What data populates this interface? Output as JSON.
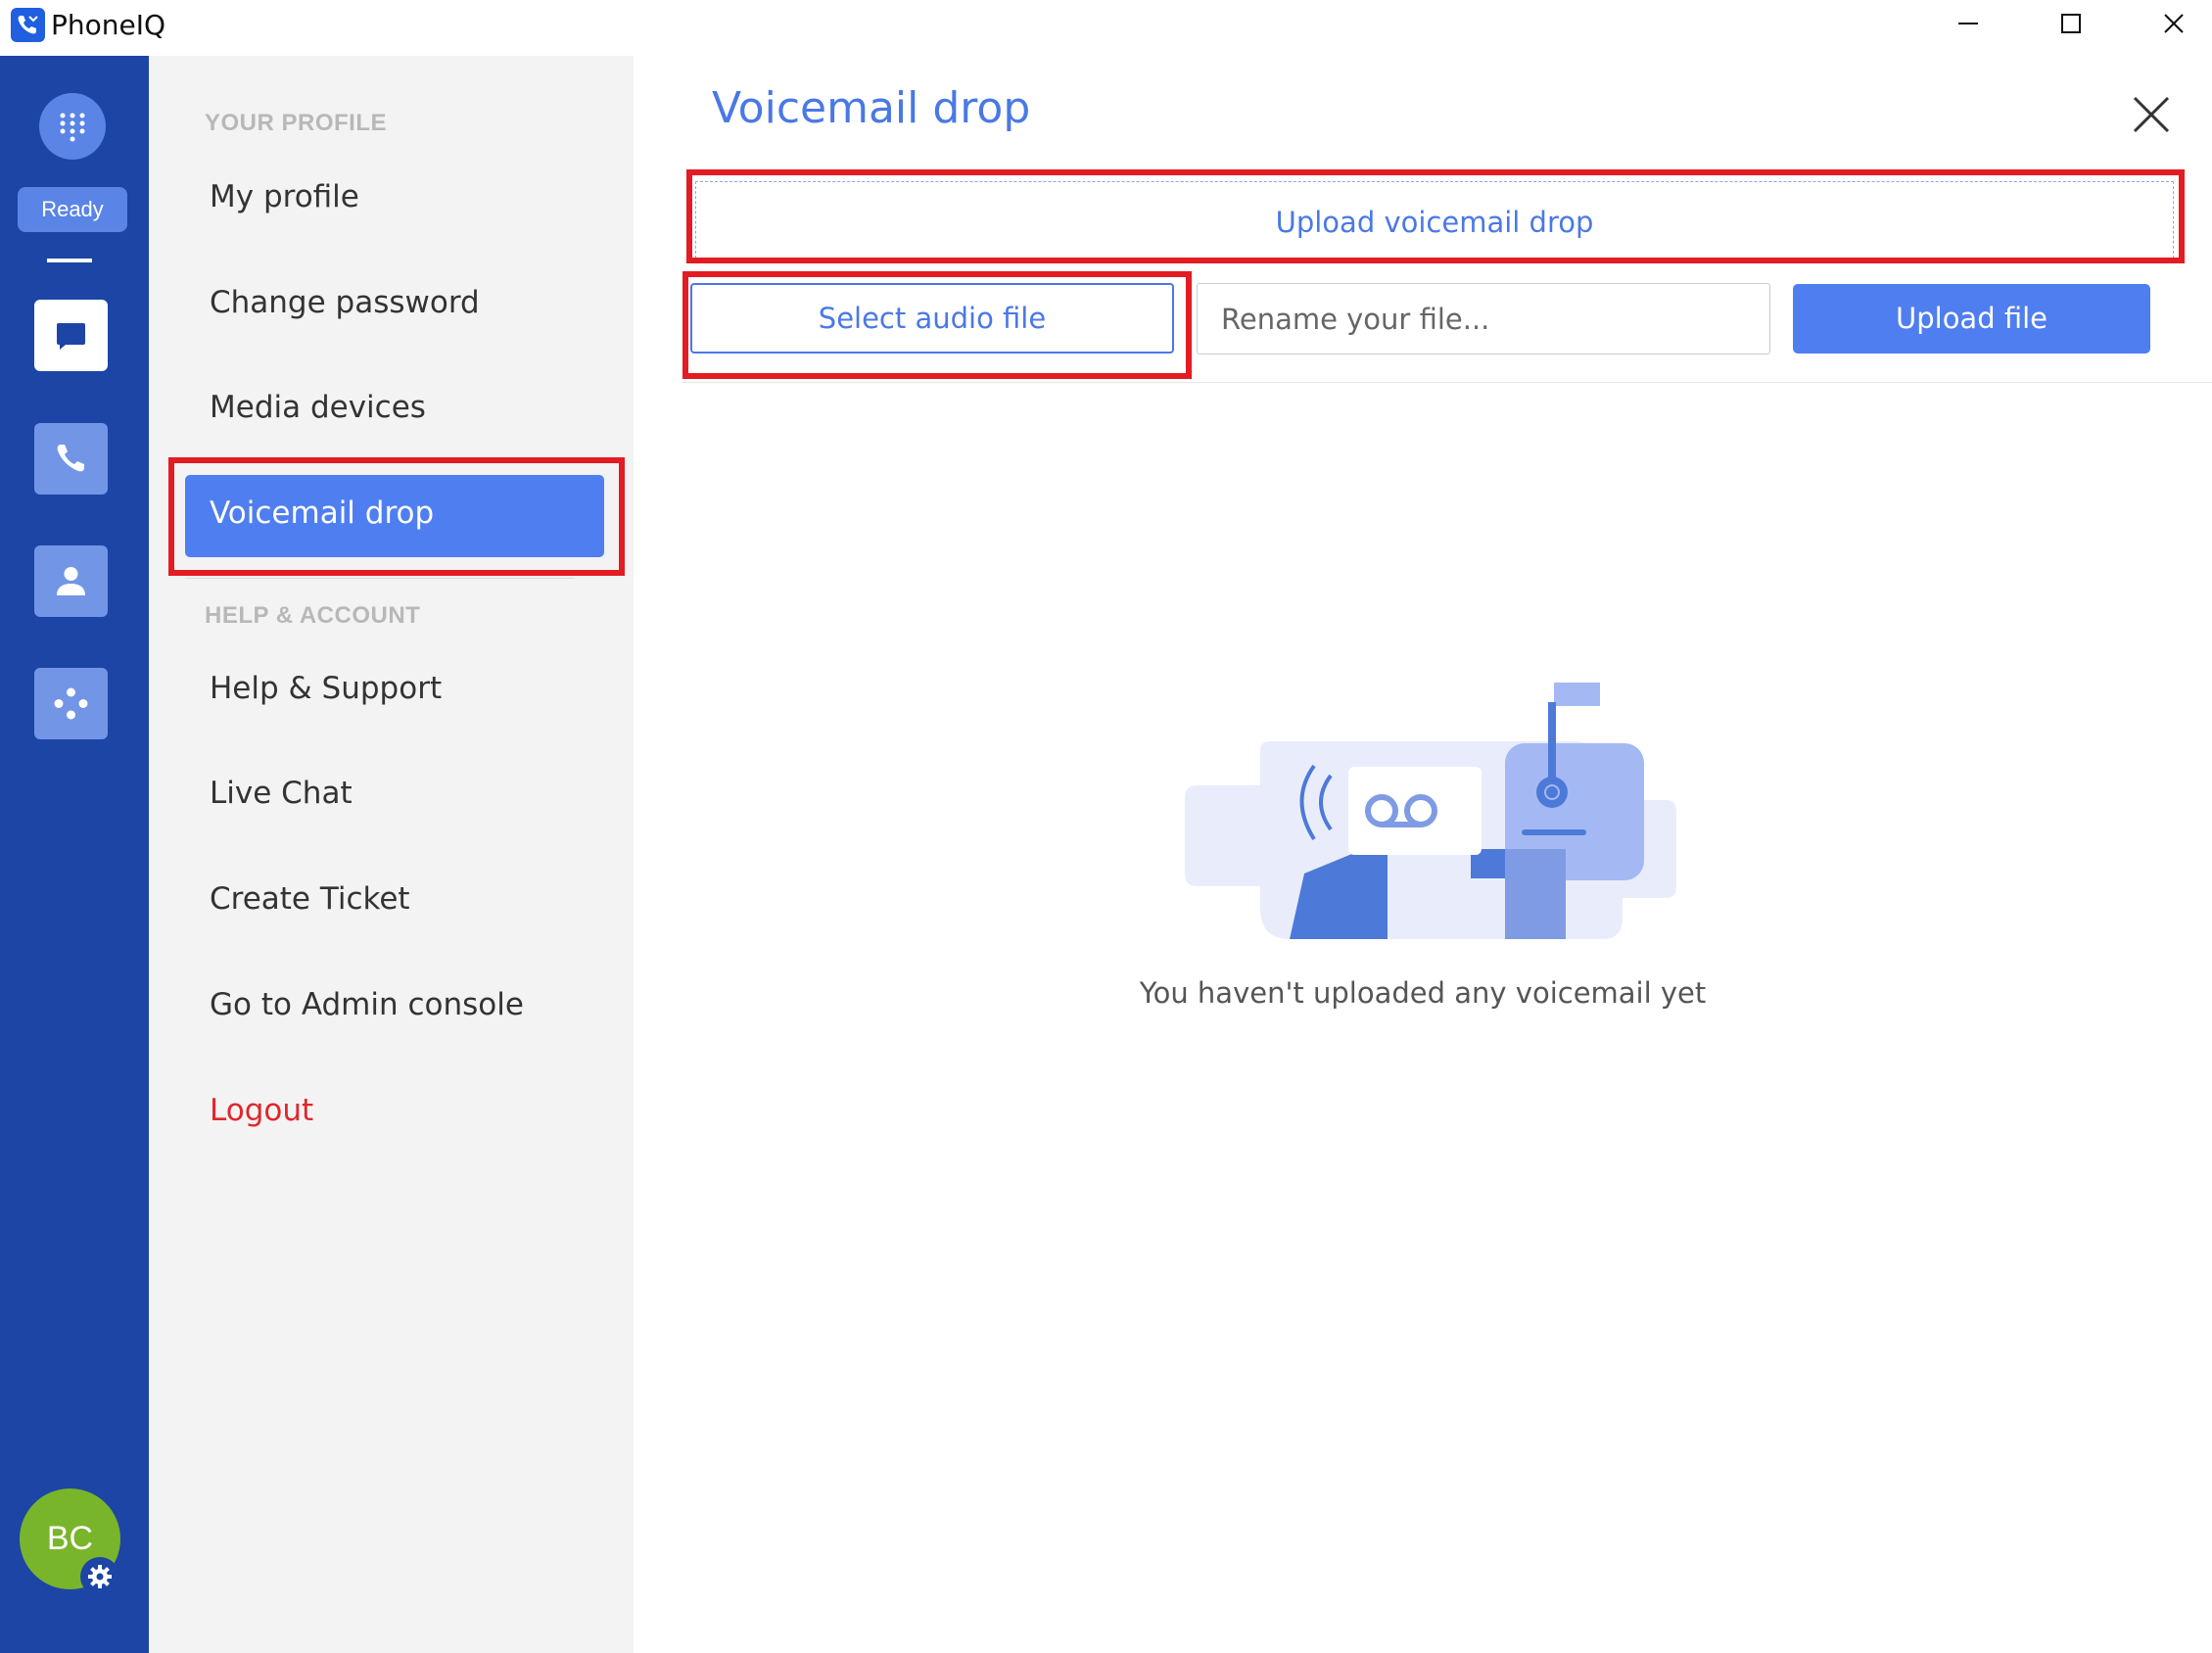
{
  "window": {
    "title": "PhoneIQ",
    "controls": [
      "minimize",
      "maximize",
      "close"
    ]
  },
  "rail": {
    "status": "Ready",
    "items": [
      "dialpad-icon",
      "message-icon",
      "phone-icon",
      "contacts-icon",
      "apps-icon"
    ],
    "active": "message-icon",
    "avatar_initials": "BC"
  },
  "menu": {
    "section_profile": "YOUR PROFILE",
    "section_help": "HELP & ACCOUNT",
    "items": {
      "my_profile": "My profile",
      "change_password": "Change password",
      "media_devices": "Media devices",
      "voicemail_drop": "Voicemail drop",
      "help_support": "Help & Support",
      "live_chat": "Live Chat",
      "create_ticket": "Create Ticket",
      "admin_console": "Go to Admin console",
      "logout": "Logout"
    },
    "active_item": "Voicemail drop"
  },
  "main": {
    "title": "Voicemail drop",
    "upload_drop_label": "Upload voicemail drop",
    "select_audio_label": "Select audio file",
    "rename_placeholder": "Rename your file...",
    "upload_file_label": "Upload file",
    "empty_message": "You haven't uploaded any voicemail yet"
  },
  "colors": {
    "rail_bg": "#1c45a6",
    "accent": "#4f7ef0",
    "title_blue": "#4a78e6",
    "logout_red": "#e0262c",
    "highlight_red": "#e31b23",
    "avatar_green": "#79b52a"
  }
}
